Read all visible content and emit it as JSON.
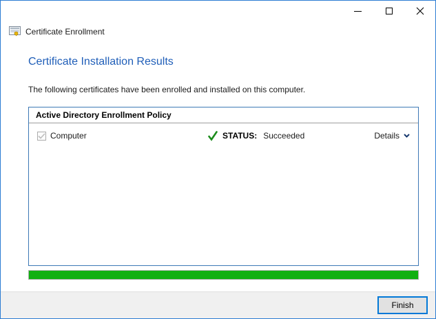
{
  "window": {
    "app_title": "Certificate Enrollment"
  },
  "titlebar": {
    "controls": [
      "minimize",
      "maximize",
      "close"
    ]
  },
  "page": {
    "title": "Certificate Installation Results",
    "description": "The following certificates have been enrolled and installed on this computer."
  },
  "panel": {
    "header": "Active Directory Enrollment Policy",
    "rows": [
      {
        "name": "Computer",
        "checkbox_checked": true,
        "status_label": "STATUS:",
        "status_value": "Succeeded",
        "details_label": "Details"
      }
    ]
  },
  "progress": {
    "percent": 100
  },
  "footer": {
    "finish_label": "Finish"
  },
  "colors": {
    "accent_border": "#2b7cd3",
    "heading_blue": "#1f5eb8",
    "panel_border": "#3c78b5",
    "progress_green": "#12b012",
    "status_check_green": "#1c8c1c",
    "chevron_blue": "#16386e"
  }
}
